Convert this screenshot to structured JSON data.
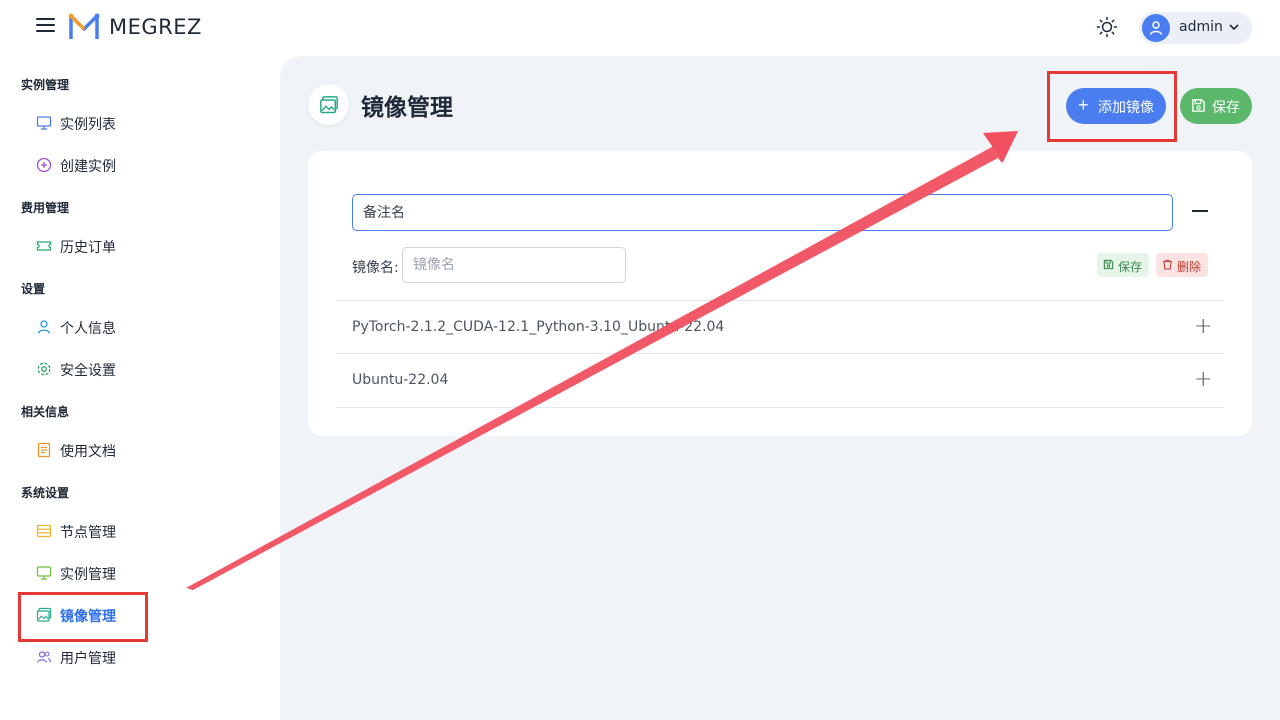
{
  "app": {
    "brand": "MEGREZ"
  },
  "header": {
    "user_name": "admin"
  },
  "sidebar": {
    "sections": [
      {
        "title": "实例管理",
        "items": [
          {
            "label": "实例列表",
            "icon": "monitor-icon"
          },
          {
            "label": "创建实例",
            "icon": "plus-circle-icon"
          }
        ]
      },
      {
        "title": "费用管理",
        "items": [
          {
            "label": "历史订单",
            "icon": "ticket-icon"
          }
        ]
      },
      {
        "title": "设置",
        "items": [
          {
            "label": "个人信息",
            "icon": "user-icon"
          },
          {
            "label": "安全设置",
            "icon": "gear-icon"
          }
        ]
      },
      {
        "title": "相关信息",
        "items": [
          {
            "label": "使用文档",
            "icon": "document-icon"
          }
        ]
      },
      {
        "title": "系统设置",
        "items": [
          {
            "label": "节点管理",
            "icon": "server-icon"
          },
          {
            "label": "实例管理",
            "icon": "monitor-icon"
          },
          {
            "label": "镜像管理",
            "icon": "image-icon",
            "active": true
          },
          {
            "label": "用户管理",
            "icon": "users-icon"
          }
        ]
      }
    ]
  },
  "page": {
    "title": "镜像管理",
    "add_button": "添加镜像",
    "save_button": "保存"
  },
  "form": {
    "remark_placeholder": "备注名",
    "image_label": "镜像名:",
    "image_placeholder": "镜像名",
    "save_label": "保存",
    "delete_label": "删除"
  },
  "images": [
    "PyTorch-2.1.2_CUDA-12.1_Python-3.10_Ubuntu-22.04",
    "Ubuntu-22.04"
  ],
  "colors": {
    "primary": "#4a7ef0",
    "success": "#5bb86a",
    "danger": "#c0392b",
    "annotation": "#e53935"
  }
}
